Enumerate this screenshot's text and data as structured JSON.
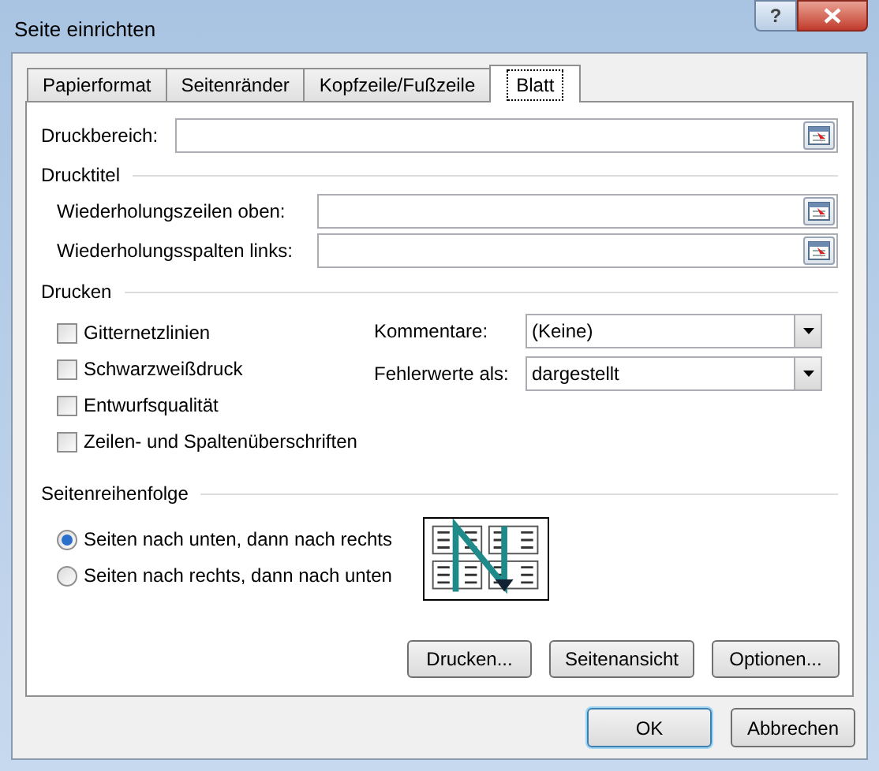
{
  "window": {
    "title": "Seite einrichten",
    "help": "?"
  },
  "tabs": [
    {
      "label": "Papierformat",
      "selected": false
    },
    {
      "label": "Seitenränder",
      "selected": false
    },
    {
      "label": "Kopfzeile/Fußzeile",
      "selected": false
    },
    {
      "label": "Blatt",
      "selected": true
    }
  ],
  "print_area": {
    "label": "Druckbereich:"
  },
  "print_titles": {
    "heading": "Drucktitel",
    "fields": [
      {
        "label": "Wiederholungszeilen oben:"
      },
      {
        "label": "Wiederholungsspalten links:"
      }
    ]
  },
  "print": {
    "heading": "Drucken",
    "checkboxes": [
      {
        "label": "Gitternetzlinien",
        "checked": false
      },
      {
        "label": "Schwarzweißdruck",
        "checked": false
      },
      {
        "label": "Entwurfsqualität",
        "checked": false
      },
      {
        "label": "Zeilen- und Spaltenüberschriften",
        "checked": false
      }
    ],
    "selects": [
      {
        "label": "Kommentare:",
        "value": "(Keine)"
      },
      {
        "label": "Fehlerwerte als:",
        "value": "dargestellt"
      }
    ]
  },
  "page_order": {
    "heading": "Seitenreihenfolge",
    "options": [
      {
        "label": "Seiten nach unten, dann nach rechts",
        "selected": true
      },
      {
        "label": "Seiten nach rechts, dann nach unten",
        "selected": false
      }
    ]
  },
  "panel_buttons": [
    "Drucken...",
    "Seitenansicht",
    "Optionen..."
  ],
  "buttons": [
    {
      "label": "OK",
      "default": true
    },
    {
      "label": "Abbrechen",
      "default": false
    }
  ]
}
